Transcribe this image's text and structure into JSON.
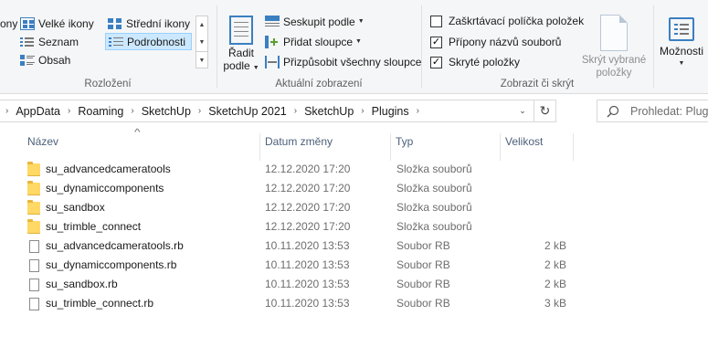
{
  "ribbon": {
    "layout": {
      "label": "Rozložení",
      "views": [
        {
          "label": "ony",
          "icon": "extra-large-icons-icon"
        },
        {
          "label": "Velké ikony",
          "icon": "large-icons-icon"
        },
        {
          "label": "Seznam",
          "icon": "list-view-icon"
        },
        {
          "label": "Obsah",
          "icon": "content-view-icon"
        },
        {
          "label": "Střední ikony",
          "icon": "medium-icons-icon"
        },
        {
          "label": "Podrobnosti",
          "icon": "details-view-icon",
          "selected": true
        }
      ]
    },
    "current_view": {
      "label": "Aktuální zobrazení",
      "sort_line1": "Řadit",
      "sort_line2": "podle",
      "group_by": "Seskupit podle",
      "add_columns": "Přidat sloupce",
      "fit_columns": "Přizpůsobit všechny sloupce"
    },
    "show_hide": {
      "label": "Zobrazit či skrýt",
      "item_checkboxes": {
        "label": "Zaškrtávací políčka položek",
        "checked": false
      },
      "file_extensions": {
        "label": "Přípony názvů souborů",
        "checked": true
      },
      "hidden_items": {
        "label": "Skryté položky",
        "checked": true
      },
      "hide_selected_line1": "Skrýt vybrané",
      "hide_selected_line2": "položky",
      "options": "Možnosti"
    }
  },
  "address": {
    "crumbs": [
      "AppData",
      "Roaming",
      "SketchUp",
      "SketchUp 2021",
      "SketchUp",
      "Plugins"
    ],
    "search_placeholder": "Prohledat: Plugins"
  },
  "table": {
    "columns": [
      "Název",
      "Datum změny",
      "Typ",
      "Velikost"
    ],
    "rows": [
      {
        "name": "su_advancedcameratools",
        "date": "12.12.2020 17:20",
        "type": "Složka souborů",
        "size": "",
        "kind": "folder"
      },
      {
        "name": "su_dynamiccomponents",
        "date": "12.12.2020 17:20",
        "type": "Složka souborů",
        "size": "",
        "kind": "folder"
      },
      {
        "name": "su_sandbox",
        "date": "12.12.2020 17:20",
        "type": "Složka souborů",
        "size": "",
        "kind": "folder"
      },
      {
        "name": "su_trimble_connect",
        "date": "12.12.2020 17:20",
        "type": "Složka souborů",
        "size": "",
        "kind": "folder"
      },
      {
        "name": "su_advancedcameratools.rb",
        "date": "10.11.2020 13:53",
        "type": "Soubor RB",
        "size": "2 kB",
        "kind": "file"
      },
      {
        "name": "su_dynamiccomponents.rb",
        "date": "10.11.2020 13:53",
        "type": "Soubor RB",
        "size": "2 kB",
        "kind": "file"
      },
      {
        "name": "su_sandbox.rb",
        "date": "10.11.2020 13:53",
        "type": "Soubor RB",
        "size": "2 kB",
        "kind": "file"
      },
      {
        "name": "su_trimble_connect.rb",
        "date": "10.11.2020 13:53",
        "type": "Soubor RB",
        "size": "3 kB",
        "kind": "file"
      }
    ]
  },
  "colors": {
    "ribbon_bg": "#f5f6f7",
    "selected_bg": "#cce8ff",
    "accent": "#3a7fc2",
    "folder": "#ffd866"
  }
}
